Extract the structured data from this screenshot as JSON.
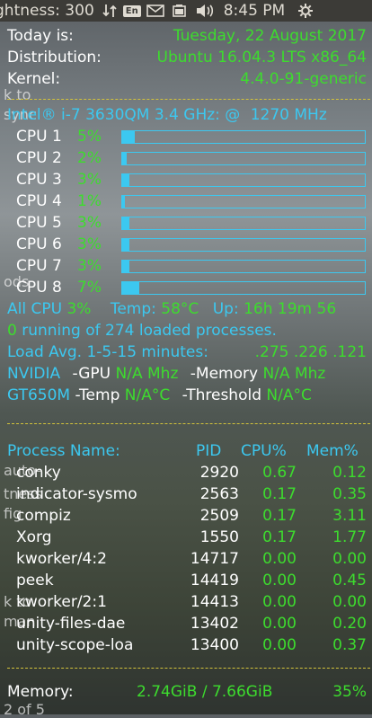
{
  "panel": {
    "brightness": "ghtness: 300",
    "lang": "En",
    "time": "8:45 PM"
  },
  "desktop": [
    "k to",
    "sync",
    "ods",
    "auto-",
    "tness",
    "fig",
    "k to",
    "man",
    "2 of 5"
  ],
  "system": {
    "today_label": "Today is:",
    "today_value": "Tuesday, 22 August 2017",
    "dist_label": "Distribution:",
    "dist_value": "Ubuntu 16.04.3 LTS x86_64",
    "kernel_label": "Kernel:",
    "kernel_value": "4.4.0-91-generic",
    "cpu_model": "Intel® i-7 3630QM 3.4 GHz: @",
    "cpu_freq": "1270 MHz"
  },
  "cpus": [
    {
      "label": "CPU 1",
      "pct": "5%",
      "level": 5
    },
    {
      "label": "CPU 2",
      "pct": "2%",
      "level": 2
    },
    {
      "label": "CPU 3",
      "pct": "3%",
      "level": 3
    },
    {
      "label": "CPU 4",
      "pct": "1%",
      "level": 1
    },
    {
      "label": "CPU 5",
      "pct": "3%",
      "level": 3
    },
    {
      "label": "CPU 6",
      "pct": "3%",
      "level": 3
    },
    {
      "label": "CPU 7",
      "pct": "3%",
      "level": 3
    },
    {
      "label": "CPU 8",
      "pct": "7%",
      "level": 7
    }
  ],
  "stats": {
    "all_cpu_label": "All CPU",
    "all_cpu_value": "3%",
    "temp_label": "Temp:",
    "temp_value": "58°C",
    "up_label": "Up:",
    "up_value": "16h 19m 56",
    "proc_running": "0",
    "proc_text": "running of 274 loaded processes.",
    "load_label": "Load Avg. 1-5-15 minutes:",
    "load_value": ".275 .226 .121",
    "nvidia": "NVIDIA",
    "gpu_label": "-GPU",
    "gpu_value": "N/A Mhz",
    "mem_label": "-Memory",
    "mem_value": "N/A Mhz",
    "gt": "GT650M",
    "temp2_label": "-Temp",
    "temp2_value": "N/A°C",
    "thr_label": "-Threshold",
    "thr_value": "N/A°C"
  },
  "process_header": {
    "name": "Process Name:",
    "pid": "PID",
    "cpu": "CPU%",
    "mem": "Mem%"
  },
  "processes": [
    {
      "name": "conky",
      "pid": "2920",
      "cpu": "0.67",
      "mem": "0.12"
    },
    {
      "name": "indicator-sysmo",
      "pid": "2563",
      "cpu": "0.17",
      "mem": "0.35"
    },
    {
      "name": "compiz",
      "pid": "2509",
      "cpu": "0.17",
      "mem": "3.11"
    },
    {
      "name": "Xorg",
      "pid": "1550",
      "cpu": "0.17",
      "mem": "1.77"
    },
    {
      "name": "kworker/4:2",
      "pid": "14717",
      "cpu": "0.00",
      "mem": "0.00"
    },
    {
      "name": "peek",
      "pid": "14419",
      "cpu": "0.00",
      "mem": "0.45"
    },
    {
      "name": "kworker/2:1",
      "pid": "14413",
      "cpu": "0.00",
      "mem": "0.00"
    },
    {
      "name": "unity-files-dae",
      "pid": "13402",
      "cpu": "0.00",
      "mem": "0.20"
    },
    {
      "name": "unity-scope-loa",
      "pid": "13400",
      "cpu": "0.00",
      "mem": "0.37"
    }
  ],
  "memory": {
    "label": "Memory:",
    "value": "2.74GiB / 7.66GiB",
    "pct": "35%"
  }
}
